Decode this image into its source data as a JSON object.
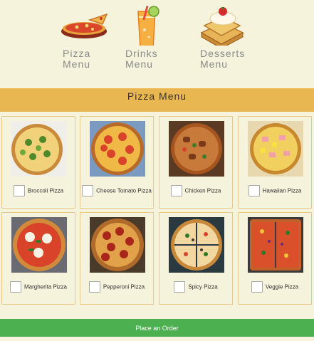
{
  "nav": {
    "pizza_label": "Pizza\nMenu",
    "drinks_label": "Drinks\nMenu",
    "desserts_label": "Desserts\nMenu"
  },
  "banner": {
    "title": "Pizza Menu"
  },
  "items": [
    {
      "label": "Broccoli Pizza",
      "checked": false
    },
    {
      "label": "Cheese Tomato Pizza",
      "checked": false
    },
    {
      "label": "Chicken Pizza",
      "checked": false
    },
    {
      "label": "Hawaiian Pizza",
      "checked": false
    },
    {
      "label": "Margherita Pizza",
      "checked": false
    },
    {
      "label": "Pepperoni Pizza",
      "checked": false
    },
    {
      "label": "Spicy Pizza",
      "checked": false
    },
    {
      "label": "Veggie Pizza",
      "checked": false
    }
  ],
  "order_button": {
    "label": "Place an Order"
  },
  "colors": {
    "banner": "#e9b752",
    "button": "#4caf50",
    "background": "#f5f3dc"
  }
}
